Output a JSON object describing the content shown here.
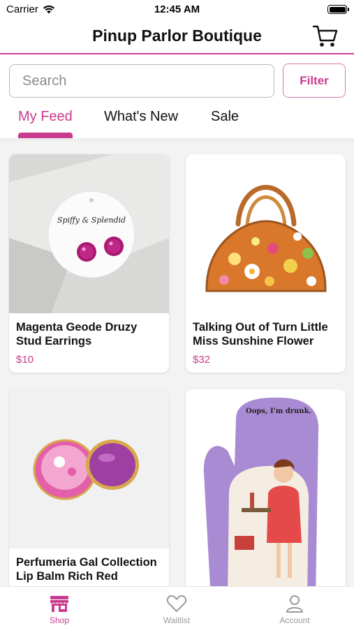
{
  "status_bar": {
    "carrier": "Carrier",
    "time": "12:45 AM"
  },
  "header": {
    "title": "Pinup Parlor Boutique",
    "cart_icon": "cart-icon"
  },
  "search": {
    "placeholder": "Search",
    "value": "",
    "filter_label": "Filter"
  },
  "tabs": [
    {
      "label": "My Feed",
      "active": true
    },
    {
      "label": "What's New",
      "active": false
    },
    {
      "label": "Sale",
      "active": false
    }
  ],
  "products": [
    {
      "name": "Magenta Geode Druzy Stud Earrings",
      "price": "$10",
      "tag_text": "Spiffy & Splendid"
    },
    {
      "name": "Talking Out of Turn Little Miss Sunshine Flower",
      "price": "$32"
    },
    {
      "name": "Perfumeria Gal Collection Lip Balm Rich Red",
      "price": ""
    },
    {
      "name": "",
      "price": "",
      "image_caption": "Oops, I'm drunk."
    }
  ],
  "tab_bar": [
    {
      "label": "Shop",
      "icon": "shop-icon",
      "active": true
    },
    {
      "label": "Waitlist",
      "icon": "heart-icon",
      "active": false
    },
    {
      "label": "Account",
      "icon": "account-icon",
      "active": false
    }
  ],
  "colors": {
    "accent": "#c93b8e",
    "divider": "#eeeeee"
  }
}
